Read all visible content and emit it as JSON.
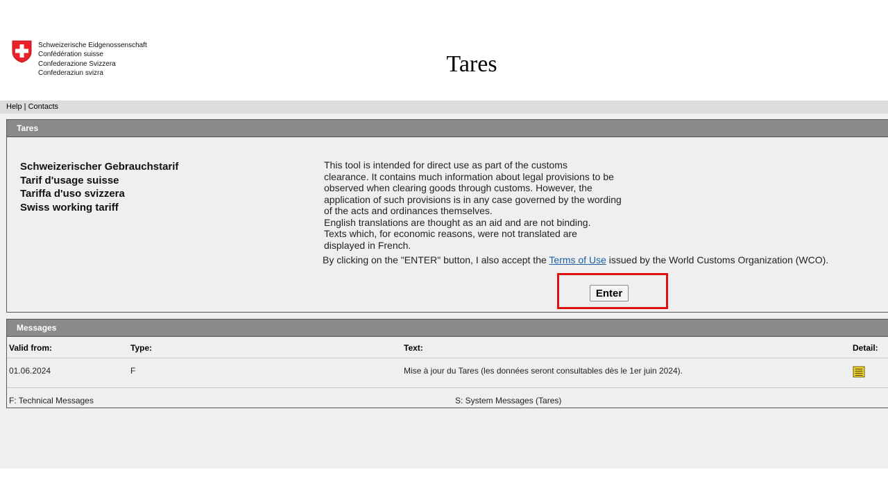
{
  "header": {
    "confederation_lines": [
      "Schweizerische Eidgenossenschaft",
      "Confédération suisse",
      "Confederazione Svizzera",
      "Confederaziun svizra"
    ],
    "app_title": "Tares"
  },
  "nav": {
    "help": "Help",
    "separator": " | ",
    "contacts": "Contacts"
  },
  "tares_panel": {
    "title": "Tares",
    "tariff_names": [
      "Schweizerischer Gebrauchstarif",
      "Tarif d'usage suisse",
      "Tariffa d'uso svizzera",
      "Swiss working tariff"
    ],
    "info_lines": [
      "This tool is intended for direct use as part of the customs",
      "clearance. It contains much information about legal provisions to be",
      "observed when clearing goods through customs. However, the",
      "application of such provisions is in any case governed by the wording",
      "of the acts and ordinances themselves.",
      "English translations are thought as an aid and are not binding.",
      "Texts which, for economic reasons, were not translated are",
      "displayed in French."
    ],
    "terms_prefix": "By clicking on the \"ENTER\" button, I also accept the ",
    "terms_link": "Terms of Use",
    "terms_suffix": " issued by the World Customs Organization (WCO).",
    "enter_label": "Enter"
  },
  "messages_panel": {
    "title": "Messages",
    "columns": {
      "valid_from": "Valid from:",
      "type": "Type:",
      "text": "Text:",
      "detail": "Detail:"
    },
    "rows": [
      {
        "valid_from": "01.06.2024",
        "type": "F",
        "text": "Mise à jour du Tares (les données seront consultables dès le 1er juin 2024).",
        "detail_icon": "document-icon"
      }
    ],
    "legend_f": "F: Technical Messages",
    "legend_s": "S: System Messages (Tares)"
  },
  "colors": {
    "panel_header": "#8a8a8a",
    "content_bg": "#efefef",
    "navbar_bg": "#dcdcdc",
    "highlight": "#e01010",
    "link": "#1a5fa0",
    "swiss_red": "#e8212b"
  }
}
